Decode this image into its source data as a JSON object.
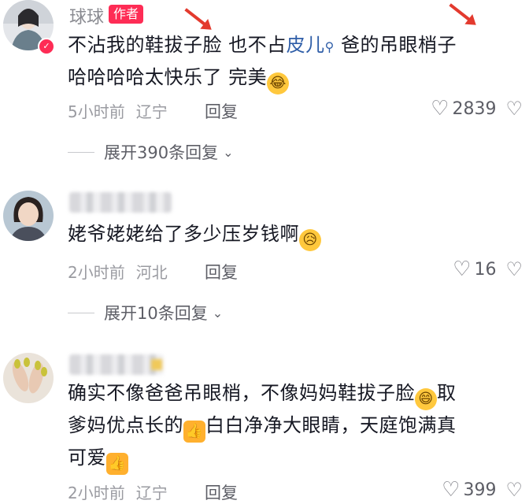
{
  "comments": [
    {
      "username": "球球",
      "author_tag": "作者",
      "text_a": "不沾我的鞋拔子脸 也不占",
      "text_link": "皮儿",
      "search_glyph": "⚲",
      "text_b": "爸的吊眼梢子",
      "text_line2": "哈哈哈哈太快乐了 完美",
      "emoji": "😂",
      "time": "5小时前",
      "location": "辽宁",
      "reply": "回复",
      "likes": "2839",
      "expand": "展开390条回复"
    },
    {
      "text": "姥爷姥姥给了多少压岁钱啊",
      "emoji": "😥",
      "time": "2小时前",
      "location": "河北",
      "reply": "回复",
      "likes": "16",
      "expand": "展开10条回复"
    },
    {
      "text_a": "确实不像爸爸吊眼梢，不像妈妈鞋拔子脸",
      "emoji_a": "😄",
      "text_b": "取",
      "text_c": "爹妈优点长的",
      "emoji_b": "👍",
      "text_d": "白白净净大眼睛，天庭饱满真",
      "text_e": "可爱",
      "emoji_c": "👍",
      "time": "2小时前",
      "location": "辽宁",
      "reply": "回复",
      "likes": "399"
    }
  ],
  "icons": {
    "heart": "♡",
    "dislike": "♡",
    "chevron": "⌄",
    "verified": "✓"
  },
  "colors": {
    "accent": "#fe2c55",
    "link": "#2f5ea8",
    "arrow": "#e33a2e"
  }
}
